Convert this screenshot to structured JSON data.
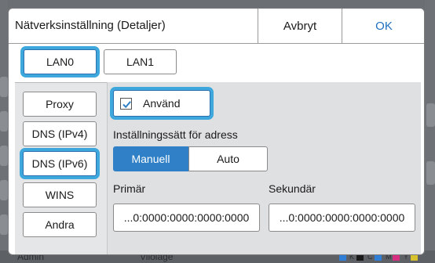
{
  "background": {
    "bottom_left_text": "Admin",
    "bottom_center_text": "Vilolägе",
    "ink_letters": [
      "K",
      "C",
      "M",
      "Y"
    ],
    "ink_colors": [
      "#1a1a1a",
      "#2f7fd6",
      "#d62f7f",
      "#d6c12f"
    ]
  },
  "dialog": {
    "title": "Nätverksinställning (Detaljer)",
    "cancel_label": "Avbryt",
    "ok_label": "OK"
  },
  "tabs": [
    {
      "label": "LAN0",
      "active": true
    },
    {
      "label": "LAN1",
      "active": false
    }
  ],
  "sidebar": {
    "items": [
      {
        "label": "Proxy"
      },
      {
        "label": "DNS (IPv4)"
      },
      {
        "label": "DNS (IPv6)",
        "selected": true
      },
      {
        "label": "WINS"
      },
      {
        "label": "Andra"
      }
    ]
  },
  "settings": {
    "use_label": "Använd",
    "use_checked": true,
    "method_label": "Inställningssätt för adress",
    "method_options": [
      "Manuell",
      "Auto"
    ],
    "method_selected": "Manuell",
    "primary_label": "Primär",
    "primary_value": "...0:0000:0000:0000:0000",
    "secondary_label": "Sekundär",
    "secondary_value": "...0:0000:0000:0000:0000"
  },
  "colors": {
    "accent": "#3ea8dc",
    "primary_blue": "#2f80c6"
  }
}
